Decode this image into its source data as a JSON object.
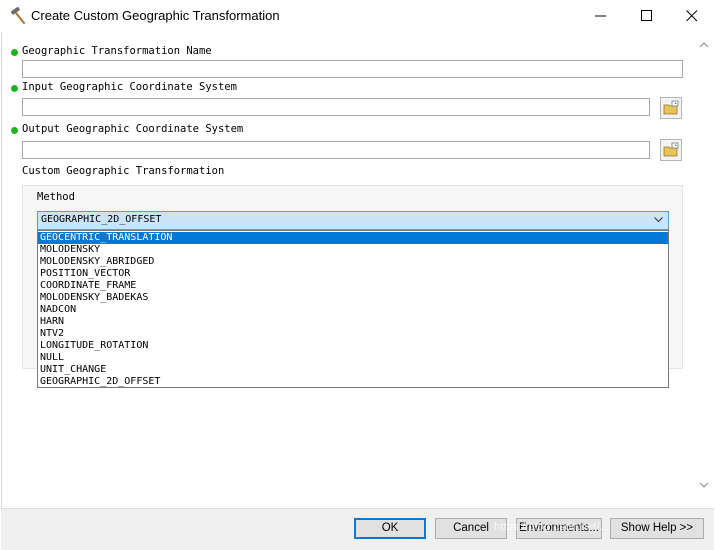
{
  "window": {
    "title": "Create Custom Geographic Transformation",
    "icon": "hammer-icon",
    "controls": [
      "minimize-icon",
      "maximize-icon",
      "close-icon"
    ]
  },
  "form": {
    "transformation_name": {
      "label": "Geographic Transformation Name",
      "value": "",
      "required": true
    },
    "input_gcs": {
      "label": "Input Geographic Coordinate System",
      "value": "",
      "required": true,
      "browse_icon": "browse-folder-icon"
    },
    "output_gcs": {
      "label": "Output Geographic Coordinate System",
      "value": "",
      "required": true,
      "browse_icon": "browse-folder-icon"
    },
    "custom_section_label": "Custom Geographic Transformation",
    "method": {
      "label": "Method",
      "selected": "GEOGRAPHIC_2D_OFFSET",
      "highlighted": "GEOCENTRIC_TRANSLATION",
      "options": [
        "GEOCENTRIC_TRANSLATION",
        "MOLODENSKY",
        "MOLODENSKY_ABRIDGED",
        "POSITION_VECTOR",
        "COORDINATE_FRAME",
        "MOLODENSKY_BADEKAS",
        "NADCON",
        "HARN",
        "NTV2",
        "LONGITUDE_ROTATION",
        "NULL",
        "UNIT_CHANGE",
        "GEOGRAPHIC_2D_OFFSET"
      ]
    }
  },
  "buttons": {
    "ok": "OK",
    "cancel": "Cancel",
    "environments": "Environments...",
    "show_help": "Show Help >>"
  },
  "watermark": "https://blog.csdn.net/..."
}
